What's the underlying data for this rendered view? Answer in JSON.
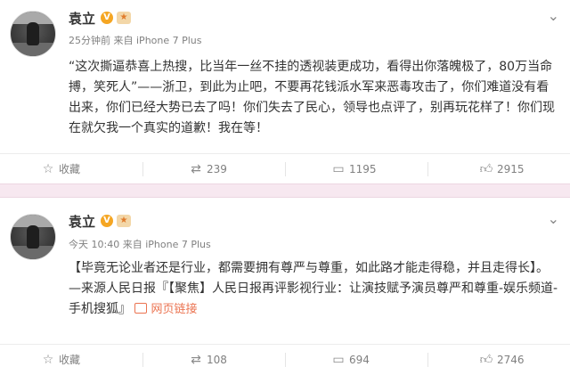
{
  "post1": {
    "author": "袁立",
    "verified_badge": "V",
    "time": "25分钟前",
    "source_prefix": "来自",
    "device": "iPhone 7 Plus",
    "text": "“这次撕逼恭喜上热搜，比当年一丝不挂的透视装更成功，看得出你落魄极了，80万当命搏，笑死人”——浙卫，到此为止吧，不要再花钱派水军来恶毒攻击了，你们难道没有看出来，你们已经大势已去了吗！你们失去了民心，领导也点评了，别再玩花样了！你们现在就欠我一个真实的道歉！我在等！",
    "actions": {
      "favorite": "收藏",
      "repost": "239",
      "comment": "1195",
      "like": "2915"
    }
  },
  "post2": {
    "author": "袁立",
    "verified_badge": "V",
    "time": "今天 10:40",
    "source_prefix": "来自",
    "device": "iPhone 7 Plus",
    "text": "【毕竟无论业者还是行业，都需要拥有尊严与尊重，如此路才能走得稳，并且走得长】。—来源人民日报『【聚焦】人民日报再评影视行业：让演技赋予演员尊严和尊重-娱乐频道-手机搜狐』",
    "link_label": "网页链接",
    "actions": {
      "favorite": "收藏",
      "repost": "108",
      "comment": "694",
      "like": "2746"
    }
  },
  "icons": {
    "chevron": "chevron-down-icon",
    "favorite": "star-icon",
    "repost": "repost-icon",
    "comment": "comment-icon",
    "like": "thumbs-up-icon"
  },
  "colors": {
    "divider": "#f7e8f0",
    "badge": "#f5a623",
    "link": "#eb7350",
    "meta": "#808080"
  }
}
